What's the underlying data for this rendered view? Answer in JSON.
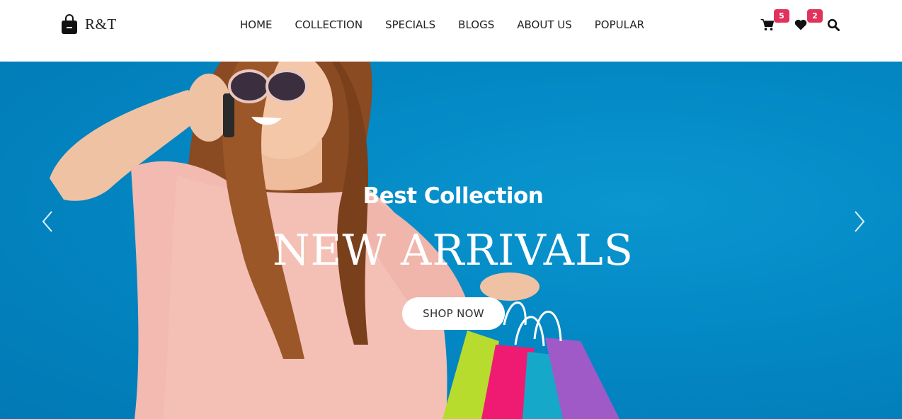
{
  "brand": {
    "name": "R&T",
    "icon": "shopping-bag-icon"
  },
  "nav": {
    "items": [
      {
        "label": "HOME"
      },
      {
        "label": "COLLECTION"
      },
      {
        "label": "SPECIALS"
      },
      {
        "label": "BLOGS"
      },
      {
        "label": "ABOUT US"
      },
      {
        "label": "POPULAR"
      }
    ]
  },
  "actions": {
    "cart": {
      "icon": "cart-icon",
      "count": "5"
    },
    "wishlist": {
      "icon": "heart-icon",
      "count": "2"
    },
    "search": {
      "icon": "search-icon"
    }
  },
  "hero": {
    "subtitle": "Best Collection",
    "title": "NEW ARRIVALS",
    "cta": "SHOP NOW",
    "prev_icon": "chevron-left-icon",
    "next_icon": "chevron-right-icon"
  },
  "colors": {
    "hero_background": "#0388c4",
    "badge": "#e0335c",
    "text_dark": "#222222"
  }
}
